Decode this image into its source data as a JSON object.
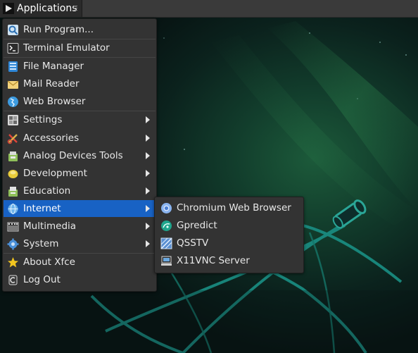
{
  "panel": {
    "apps_label": "Applications"
  },
  "colors": {
    "highlight": "#1862c4",
    "menu_bg": "#333333",
    "panel_bg": "#3a3a3a",
    "desktop_bg": "#071312",
    "accent_teal": "#1f8d84"
  },
  "main_menu": {
    "items": [
      {
        "label": "Run Program...",
        "icon": "run-program-icon",
        "submenu": false
      },
      {
        "label": "Terminal Emulator",
        "icon": "terminal-icon",
        "submenu": false
      },
      {
        "label": "File Manager",
        "icon": "file-manager-icon",
        "submenu": false
      },
      {
        "label": "Mail Reader",
        "icon": "mail-icon",
        "submenu": false
      },
      {
        "label": "Web Browser",
        "icon": "web-browser-icon",
        "submenu": false
      },
      {
        "label": "Settings",
        "icon": "settings-icon",
        "submenu": true
      },
      {
        "label": "Accessories",
        "icon": "accessories-icon",
        "submenu": true
      },
      {
        "label": "Analog Devices Tools",
        "icon": "analog-devices-tools-icon",
        "submenu": true
      },
      {
        "label": "Development",
        "icon": "development-icon",
        "submenu": true
      },
      {
        "label": "Education",
        "icon": "education-icon",
        "submenu": true
      },
      {
        "label": "Internet",
        "icon": "internet-icon",
        "submenu": true,
        "active": true
      },
      {
        "label": "Multimedia",
        "icon": "multimedia-icon",
        "submenu": true
      },
      {
        "label": "System",
        "icon": "system-icon",
        "submenu": true
      },
      {
        "label": "About Xfce",
        "icon": "star-icon",
        "submenu": false
      },
      {
        "label": "Log Out",
        "icon": "logout-icon",
        "submenu": false
      }
    ]
  },
  "internet_submenu": {
    "items": [
      {
        "label": "Chromium Web Browser",
        "icon": "chromium-icon"
      },
      {
        "label": "Gpredict",
        "icon": "gpredict-icon"
      },
      {
        "label": "QSSTV",
        "icon": "qsstv-icon"
      },
      {
        "label": "X11VNC Server",
        "icon": "x11vnc-icon"
      }
    ]
  }
}
